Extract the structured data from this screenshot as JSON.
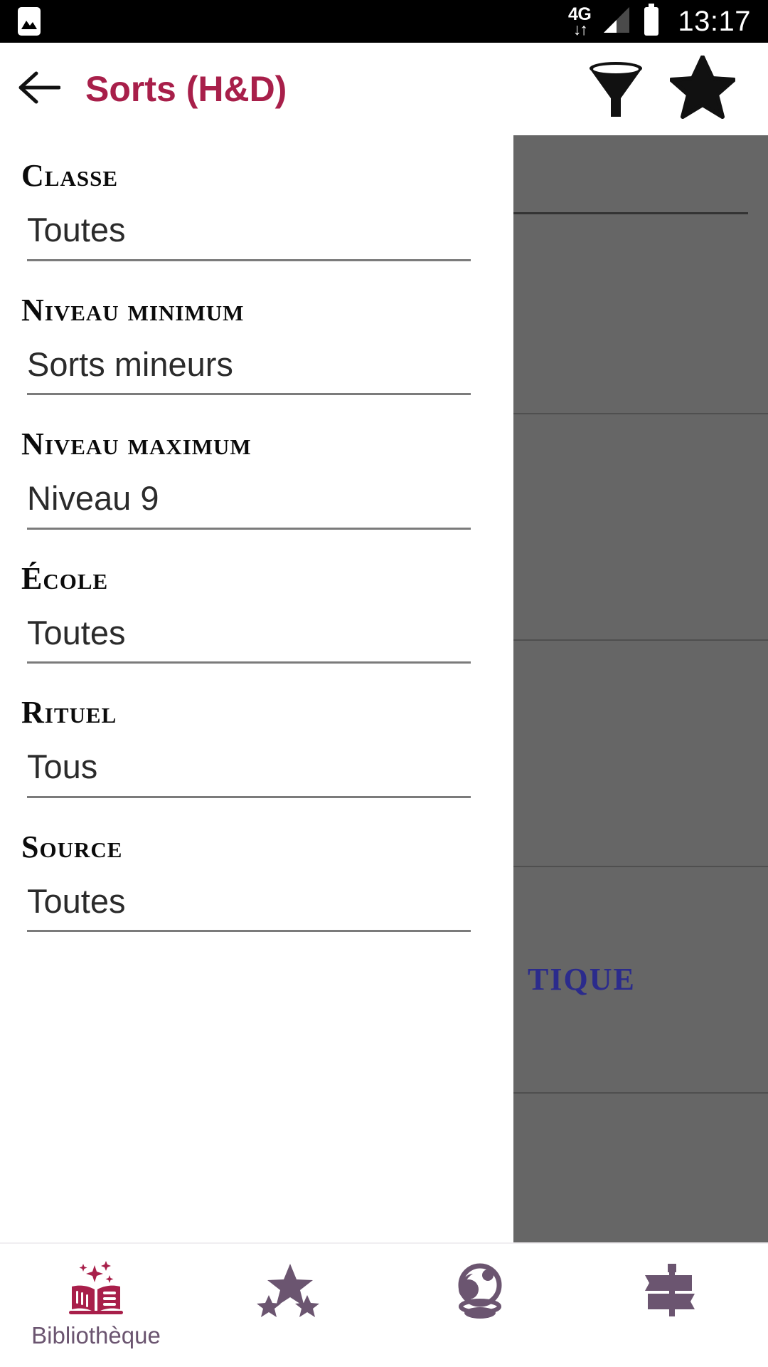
{
  "statusbar": {
    "photo_icon": "photo-icon",
    "network_label": "4G",
    "network_arrows": "↓↑",
    "signal_icon": "signal-bars-icon",
    "battery_icon": "battery-icon",
    "time": "13:17"
  },
  "appbar": {
    "back_icon": "back-arrow-icon",
    "title": "Sorts (H&D)",
    "filter_icon": "funnel-filter-icon",
    "favorite_icon": "star-icon",
    "title_color": "#a81f4a"
  },
  "filters": {
    "fields": [
      {
        "label": "Classe",
        "value": "Toutes"
      },
      {
        "label": "Niveau Minimum",
        "value": "Sorts mineurs"
      },
      {
        "label": "Niveau Maximum",
        "value": "Niveau 9"
      },
      {
        "label": "École",
        "value": "Toutes"
      },
      {
        "label": "Rituel",
        "value": "Tous"
      },
      {
        "label": "Source",
        "value": "Toutes"
      }
    ]
  },
  "background_list": {
    "visible_text": "TIQUE",
    "text_color": "#2b2b8c",
    "scrim_color": "#666666"
  },
  "bottomnav": {
    "items": [
      {
        "label": "Bibliothèque",
        "icon": "magic-book-icon",
        "selected": true,
        "color": "#a81f4a"
      },
      {
        "label": "",
        "icon": "three-stars-icon",
        "selected": false,
        "color": "#6b5570"
      },
      {
        "label": "",
        "icon": "crystal-ball-icon",
        "selected": false,
        "color": "#6b5570"
      },
      {
        "label": "",
        "icon": "signpost-icon",
        "selected": false,
        "color": "#6b5570"
      }
    ]
  }
}
